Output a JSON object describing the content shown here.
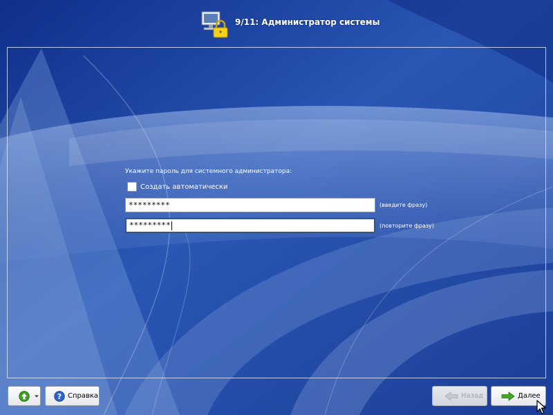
{
  "header": {
    "title": "9/11: Администратор системы",
    "icon": "computer-lock-icon"
  },
  "form": {
    "prompt": "Укажите пароль для системного администратора:",
    "auto_checkbox": {
      "label": "Создать автоматически",
      "checked": false
    },
    "password": {
      "value": "*********",
      "hint": "(введите фразу)"
    },
    "password_confirm": {
      "value": "*********",
      "hint": "(повторите фразу)"
    }
  },
  "buttons": {
    "menu": {
      "icon": "up-arrow-icon"
    },
    "help": {
      "label": "Справка",
      "icon": "question-icon"
    },
    "back": {
      "label": "Назад",
      "icon": "left-arrow-icon",
      "enabled": false
    },
    "next": {
      "label": "Далее",
      "icon": "right-arrow-icon",
      "enabled": true
    }
  },
  "colors": {
    "background": "#1e4aa6",
    "accent_green": "#3aa020"
  }
}
